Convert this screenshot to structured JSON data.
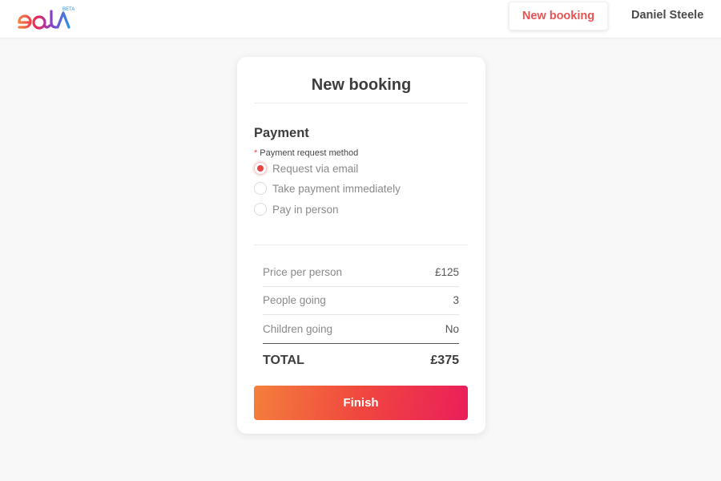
{
  "header": {
    "logo": {
      "text": "eola",
      "badge": "BETA"
    },
    "nav_button": "New booking",
    "user_name": "Daniel Steele"
  },
  "card": {
    "title": "New booking",
    "section_title": "Payment",
    "field": {
      "required_mark": "*",
      "label": "Payment request method",
      "options": [
        {
          "label": "Request via email",
          "selected": true
        },
        {
          "label": "Take payment immediately",
          "selected": false
        },
        {
          "label": "Pay in person",
          "selected": false
        }
      ]
    },
    "summary": {
      "rows": [
        {
          "label": "Price per person",
          "value": "£125"
        },
        {
          "label": "People going",
          "value": "3"
        },
        {
          "label": "Children going",
          "value": "No"
        }
      ],
      "total_label": "TOTAL",
      "total_value": "£375"
    },
    "finish_label": "Finish"
  },
  "colors": {
    "accent": "#e84545",
    "gradient_start": "#f47f3c",
    "gradient_end": "#ea1e5a"
  }
}
